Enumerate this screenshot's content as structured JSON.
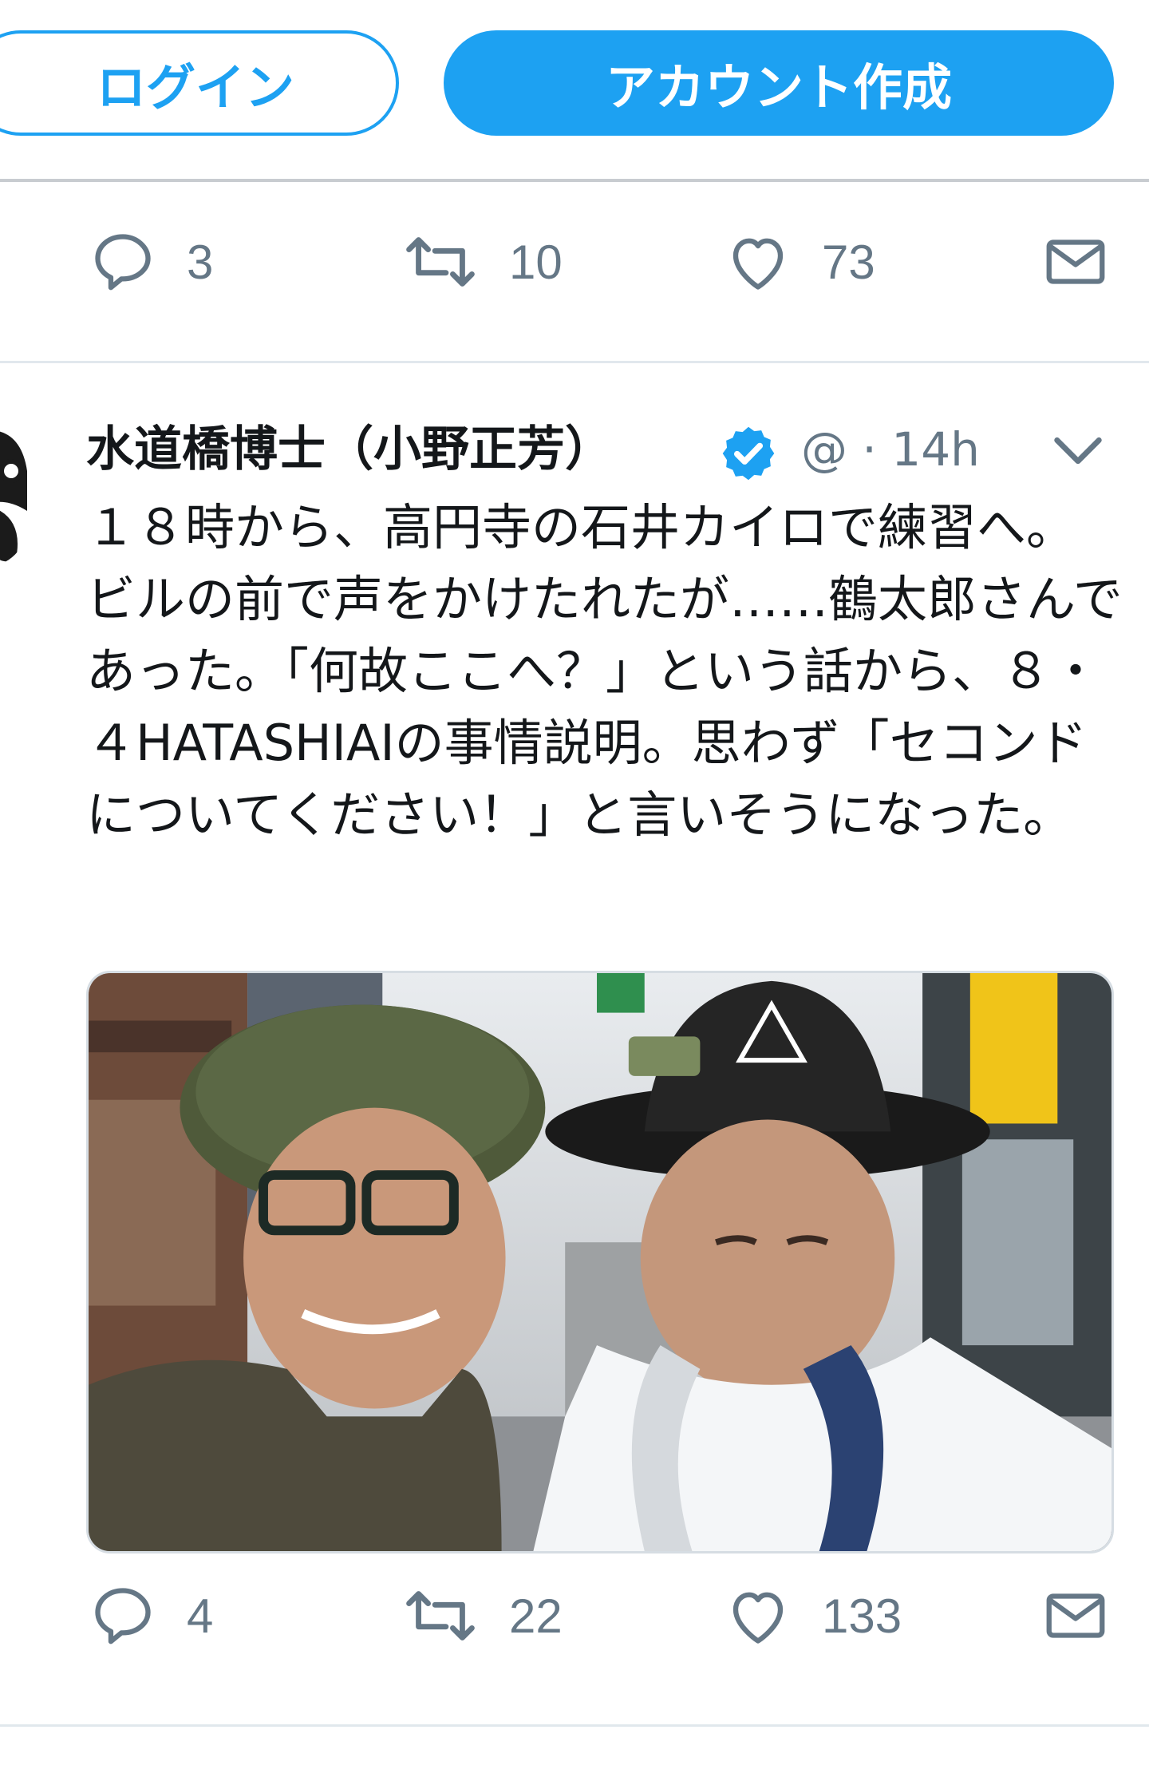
{
  "auth": {
    "login_label": "ログイン",
    "signup_label": "アカウント作成"
  },
  "colors": {
    "brand": "#1da1f2",
    "muted": "#657786",
    "text": "#14171a",
    "divider": "#e1e8ed"
  },
  "previous_tweet": {
    "replies": "3",
    "retweets": "10",
    "likes": "73"
  },
  "tweet": {
    "author_name": "水道橋博士（小野正芳）",
    "handle_time": "@ · 14h",
    "text": "１８時から、高円寺の石井カイロで練習へ。ビルの前で声をかけたれたが……鶴太郎さんであった。「何故ここへ？」という話から、８・４HATASHIAIの事情説明。思わず「セコンドについてください！」と言いそうになった。",
    "replies": "4",
    "retweets": "22",
    "likes": "133"
  },
  "icons": {
    "reply": "reply-icon",
    "retweet": "retweet-icon",
    "like": "heart-icon",
    "dm": "envelope-icon",
    "verified": "verified-badge-icon",
    "menu": "chevron-down-icon"
  }
}
